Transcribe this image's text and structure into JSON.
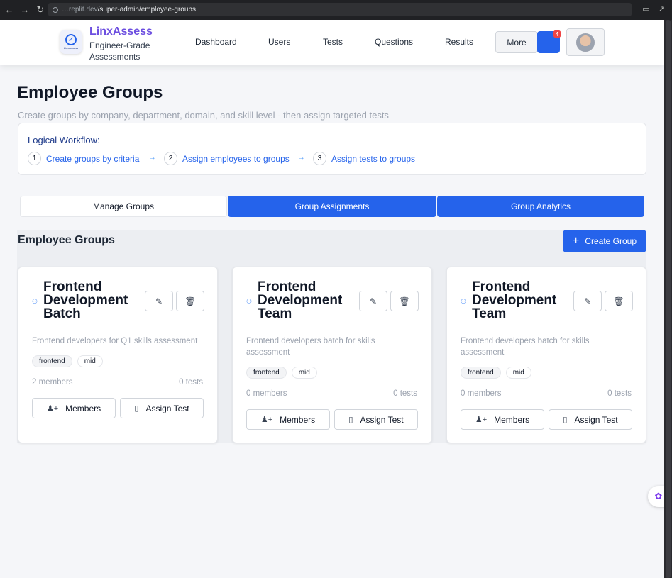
{
  "browser": {
    "url_host": "…replit.dev",
    "url_path": "/super-admin/employee-groups"
  },
  "header": {
    "brand_name": "LinxAssess",
    "brand_tagline": "Engineer-Grade Assessments",
    "logo_text": "LinxAssess",
    "nav": [
      "Dashboard",
      "Users",
      "Tests",
      "Questions",
      "Results"
    ],
    "more_label": "More",
    "notification_count": "4"
  },
  "page": {
    "title": "Employee Groups",
    "subtitle": "Create groups by company, department, domain, and skill level - then assign targeted tests"
  },
  "workflow": {
    "title": "Logical Workflow:",
    "steps": [
      {
        "num": "1",
        "label": "Create groups by criteria"
      },
      {
        "num": "2",
        "label": "Assign employees to groups"
      },
      {
        "num": "3",
        "label": "Assign tests to groups"
      }
    ],
    "arrow": "→"
  },
  "tabs": [
    {
      "label": "Manage Groups",
      "active": false
    },
    {
      "label": "Group Assignments",
      "active": true
    },
    {
      "label": "Group Analytics",
      "active": true
    }
  ],
  "section": {
    "title": "Employee Groups",
    "create_label": "Create Group"
  },
  "cards": [
    {
      "name": "Frontend Development Batch",
      "description": "Frontend developers for Q1 skills assessment",
      "tags": [
        "frontend",
        "mid"
      ],
      "members": "2 members",
      "tests": "0 tests",
      "members_btn": "Members",
      "assign_btn": "Assign Test"
    },
    {
      "name": "Frontend Development Team",
      "description": "Frontend developers batch for skills assessment",
      "tags": [
        "frontend",
        "mid"
      ],
      "members": "0 members",
      "tests": "0 tests",
      "members_btn": "Members",
      "assign_btn": "Assign Test"
    },
    {
      "name": "Frontend Development Team",
      "description": "Frontend developers batch for skills assessment",
      "tags": [
        "frontend",
        "mid"
      ],
      "members": "0 members",
      "tests": "0 tests",
      "members_btn": "Members",
      "assign_btn": "Assign Test"
    }
  ],
  "colors": {
    "primary": "#2563eb",
    "brand": "#6d4fe0",
    "badge": "#ef4444"
  },
  "icons": [
    "back-icon",
    "forward-icon",
    "reload-icon",
    "lock-icon",
    "pencil-icon",
    "trash-icon",
    "user-plus-icon",
    "test-tube-icon",
    "users-icon",
    "plus-icon",
    "bell-icon",
    "brain-icon"
  ]
}
